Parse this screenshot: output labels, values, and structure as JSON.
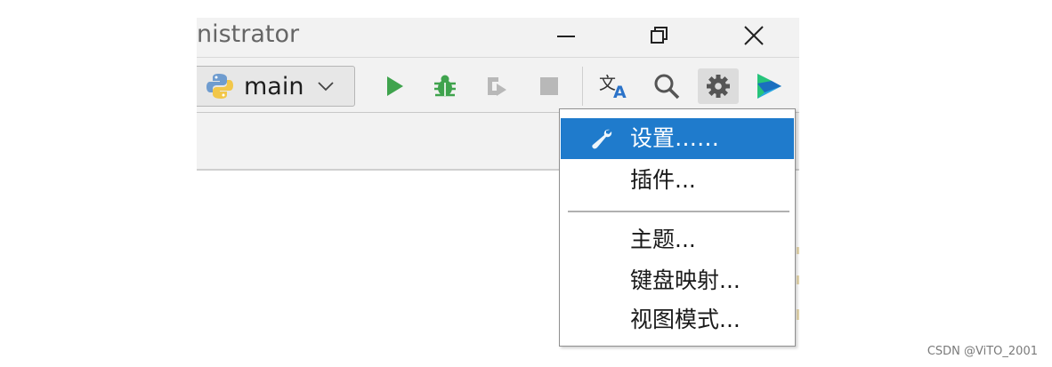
{
  "window": {
    "title_fragment": "nistrator",
    "controls": {
      "minimize": "minimize-icon",
      "restore": "restore-icon",
      "close": "close-icon"
    }
  },
  "toolbar": {
    "run_config": {
      "label": "main",
      "icon": "python-icon",
      "dropdown_icon": "chevron-down-icon"
    },
    "buttons": [
      {
        "name": "run-button",
        "icon": "play-icon",
        "color": "#3fa34d"
      },
      {
        "name": "debug-button",
        "icon": "bug-icon",
        "color": "#3fa34d"
      },
      {
        "name": "run-coverage-button",
        "icon": "coverage-icon",
        "color": "#b8b8b8"
      },
      {
        "name": "stop-button",
        "icon": "stop-icon",
        "color": "#b8b8b8"
      },
      {
        "name": "translate-button",
        "icon": "translate-icon",
        "color": "#2b73c9"
      },
      {
        "name": "search-everywhere-button",
        "icon": "search-icon",
        "color": "#555555"
      },
      {
        "name": "settings-button",
        "icon": "gear-icon",
        "color": "#555555",
        "active": true
      },
      {
        "name": "code-with-me-button",
        "icon": "codewithme-icon",
        "color": "#2aa7e2"
      }
    ]
  },
  "settings_menu": {
    "items": [
      {
        "label": "设置……",
        "icon": "wrench-icon",
        "selected": true
      },
      {
        "label": "插件..."
      },
      {
        "label": "主题..."
      },
      {
        "label": "键盘映射..."
      },
      {
        "label": "视图模式..."
      }
    ]
  },
  "colors": {
    "selection": "#1f7bcc",
    "window_bg": "#f2f2f2",
    "run_green": "#3fa34d"
  },
  "watermark": "CSDN @ViTO_2001"
}
